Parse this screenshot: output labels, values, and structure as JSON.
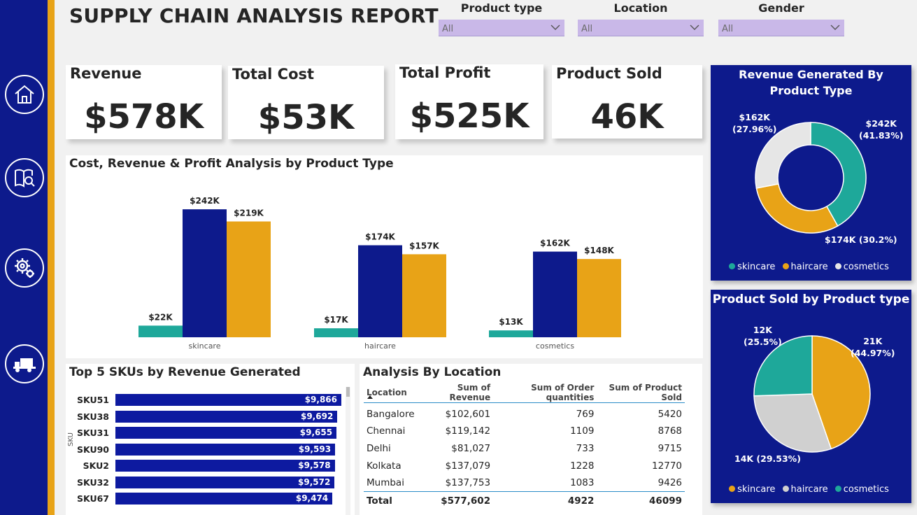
{
  "title": "SUPPLY CHAIN ANALYSIS REPORT",
  "colors": {
    "navy": "#0d1a8c",
    "teal": "#1ea89a",
    "orange": "#e8a317",
    "gray": "#e6e6e6",
    "slicer": "#c9b8e8"
  },
  "sidebar": {
    "icons": [
      "home-icon",
      "book-search-icon",
      "gears-icon",
      "truck-icon"
    ]
  },
  "filters": [
    {
      "label": "Product type",
      "value": "All"
    },
    {
      "label": "Location",
      "value": "All"
    },
    {
      "label": "Gender",
      "value": "All"
    }
  ],
  "kpis": [
    {
      "label": "Revenue",
      "value": "$578K"
    },
    {
      "label": "Total Cost",
      "value": "$53K"
    },
    {
      "label": "Total Profit",
      "value": "$525K"
    },
    {
      "label": "Product Sold",
      "value": "46K"
    }
  ],
  "chart_data": [
    {
      "type": "bar",
      "title": "Cost, Revenue & Profit Analysis by Product Type",
      "categories": [
        "skincare",
        "haircare",
        "cosmetics"
      ],
      "series": [
        {
          "values": [
            22,
            17,
            13
          ],
          "labels": [
            "$22K",
            "$17K",
            "$13K"
          ],
          "color": "#1ea89a"
        },
        {
          "values": [
            242,
            174,
            162
          ],
          "labels": [
            "$242K",
            "$174K",
            "$162K"
          ],
          "color": "#0d1a8c"
        },
        {
          "values": [
            219,
            157,
            148
          ],
          "labels": [
            "$219K",
            "$157K",
            "$148K"
          ],
          "color": "#e8a317"
        }
      ],
      "ylim": [
        0,
        262
      ]
    },
    {
      "type": "bar",
      "orientation": "horizontal",
      "title": "Top 5 SKUs by Revenue Generated",
      "ylabel": "SKU",
      "categories": [
        "SKU51",
        "SKU38",
        "SKU31",
        "SKU90",
        "SKU2",
        "SKU32",
        "SKU67"
      ],
      "values": [
        9866,
        9692,
        9655,
        9593,
        9578,
        9572,
        9474
      ],
      "labels": [
        "$9,866",
        "$9,692",
        "$9,655",
        "$9,593",
        "$9,578",
        "$9,572",
        "$9,474"
      ]
    },
    {
      "type": "pie",
      "variant": "donut",
      "title": "Revenue Generated By Product Type",
      "categories": [
        "skincare",
        "haircare",
        "cosmetics"
      ],
      "values": [
        242,
        174,
        162
      ],
      "percent": [
        41.83,
        30.2,
        27.96
      ],
      "labels": [
        "$242K\n(41.83%)",
        "$174K (30.2%)",
        "$162K\n(27.96%)"
      ],
      "colors": [
        "#1ea89a",
        "#e8a317",
        "#e6e6e6"
      ]
    },
    {
      "type": "pie",
      "title": "Product Sold by Product type",
      "categories": [
        "skincare",
        "haircare",
        "cosmetics"
      ],
      "values": [
        21,
        14,
        12
      ],
      "percent": [
        44.97,
        29.53,
        25.5
      ],
      "labels": [
        "21K\n(44.97%)",
        "14K (29.53%)",
        "12K\n(25.5%)"
      ],
      "colors": [
        "#e8a317",
        "#d0d0d0",
        "#1ea89a"
      ]
    },
    {
      "type": "table",
      "title": "Analysis By Location",
      "columns": [
        "Location",
        "Sum of Revenue",
        "Sum of Order quantities",
        "Sum of Product Sold"
      ],
      "rows": [
        [
          "Bangalore",
          "$102,601",
          "769",
          "5420"
        ],
        [
          "Chennai",
          "$119,142",
          "1109",
          "8768"
        ],
        [
          "Delhi",
          "$81,027",
          "733",
          "9715"
        ],
        [
          "Kolkata",
          "$137,079",
          "1228",
          "12770"
        ],
        [
          "Mumbai",
          "$137,753",
          "1083",
          "9426"
        ]
      ],
      "total": [
        "Total",
        "$577,602",
        "4922",
        "46099"
      ]
    }
  ],
  "legend_donut": [
    "skincare",
    "haircare",
    "cosmetics"
  ],
  "legend_pie": [
    "skincare",
    "haircare",
    "cosmetics"
  ]
}
